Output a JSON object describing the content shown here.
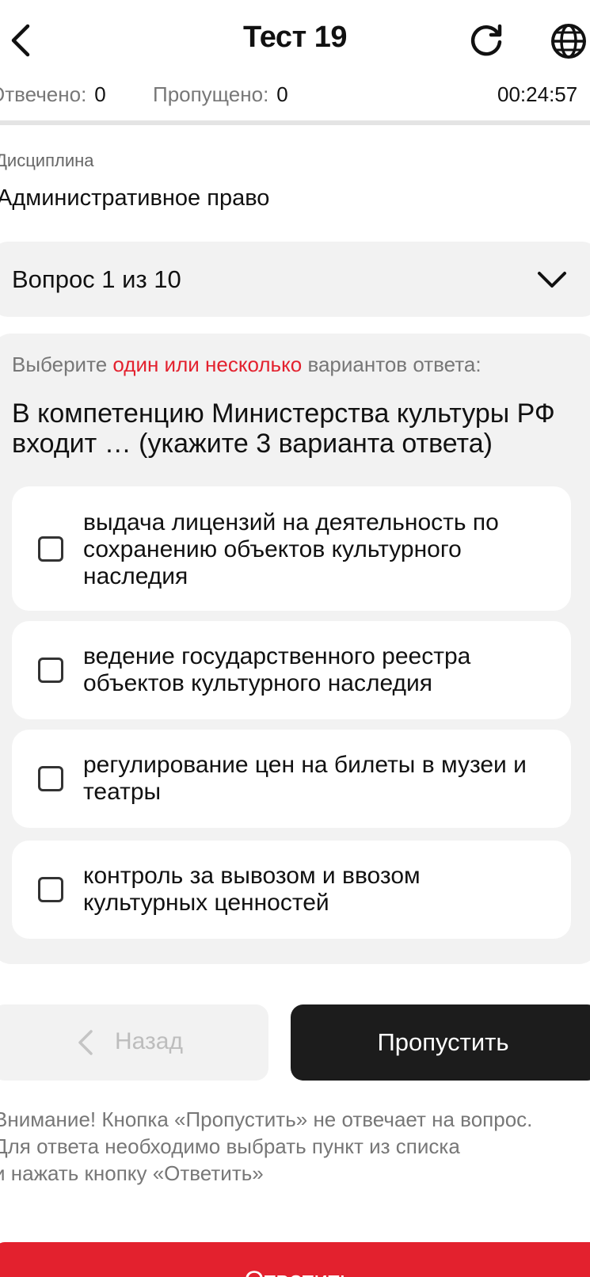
{
  "header": {
    "title": "Тест 19",
    "back_icon": "chevron-left-icon",
    "refresh_icon": "refresh-icon",
    "language_icon": "globe-icon"
  },
  "stats": {
    "answered_label": "Отвечено:",
    "answered_value": "0",
    "skipped_label": "Пропущено:",
    "skipped_value": "0",
    "timer": "00:24:57"
  },
  "discipline": {
    "label": "Дисциплина",
    "value": "Административное право"
  },
  "question_selector": {
    "label": "Вопрос 1 из 10",
    "icon": "chevron-down-icon"
  },
  "question": {
    "instruction_prefix": "Выберите",
    "instruction_accent": "один или несколько",
    "instruction_suffix": "вариантов ответа:",
    "text": "В компетенцию Министерства культуры РФ входит … (укажите 3 варианта ответа)",
    "options": [
      {
        "label": "выдача лицензий на деятельность по сохранению объектов культурного наследия",
        "checked": false
      },
      {
        "label": "ведение государственного реестра объектов культурного наследия",
        "checked": false
      },
      {
        "label": "регулирование цен на билеты в музеи и театры",
        "checked": false
      },
      {
        "label": "контроль за вывозом и ввозом культурных ценностей",
        "checked": false
      }
    ]
  },
  "buttons": {
    "back_label": "Назад",
    "skip_label": "Пропустить",
    "answer_label": "Ответить"
  },
  "notice": {
    "line1": "Внимание! Кнопка «Пропустить» не отвечает на вопрос.",
    "line2": "Для ответа необходимо выбрать пункт из списка",
    "line3": "и нажать кнопку «Ответить»"
  },
  "colors": {
    "accent_red": "#e3212e",
    "dark_button": "#1c1c1c",
    "card_gray": "#f2f2f2"
  }
}
